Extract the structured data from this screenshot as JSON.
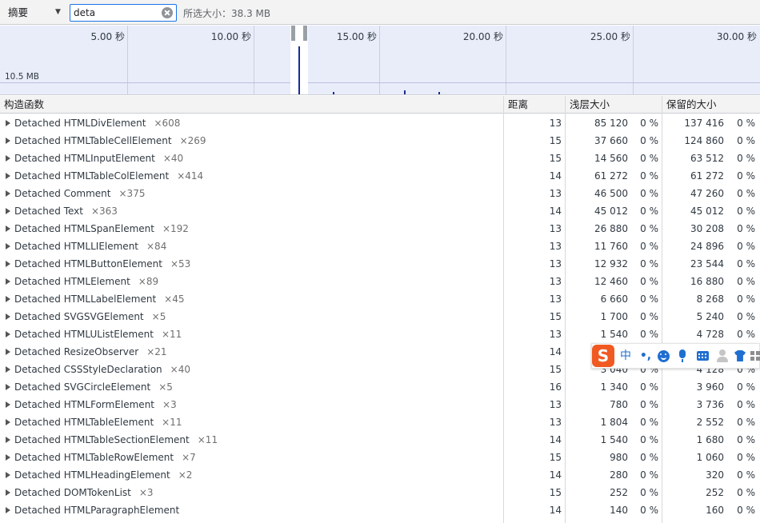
{
  "toolbar": {
    "view_mode": "摘要",
    "filter_value": "deta",
    "selected_size": "所选大小：38.3 MB"
  },
  "timeline": {
    "ticks": [
      "5.00 秒",
      "10.00 秒",
      "15.00 秒",
      "20.00 秒",
      "25.00 秒",
      "30.00 秒"
    ],
    "memory_label": "10.5 MB",
    "accent_color": "#1a2a9c"
  },
  "table": {
    "columns": {
      "constructor": "构造函数",
      "distance": "距离",
      "shallow_size": "浅层大小",
      "retained_size": "保留的大小"
    },
    "rows": [
      {
        "name": "Detached HTMLDivElement",
        "count": "×608",
        "distance": "13",
        "shallow": "85 120",
        "shallow_pct": "0 %",
        "retained": "137 416",
        "retained_pct": "0 %"
      },
      {
        "name": "Detached HTMLTableCellElement",
        "count": "×269",
        "distance": "15",
        "shallow": "37 660",
        "shallow_pct": "0 %",
        "retained": "124 860",
        "retained_pct": "0 %"
      },
      {
        "name": "Detached HTMLInputElement",
        "count": "×40",
        "distance": "15",
        "shallow": "14 560",
        "shallow_pct": "0 %",
        "retained": "63 512",
        "retained_pct": "0 %"
      },
      {
        "name": "Detached HTMLTableColElement",
        "count": "×414",
        "distance": "14",
        "shallow": "61 272",
        "shallow_pct": "0 %",
        "retained": "61 272",
        "retained_pct": "0 %"
      },
      {
        "name": "Detached Comment",
        "count": "×375",
        "distance": "13",
        "shallow": "46 500",
        "shallow_pct": "0 %",
        "retained": "47 260",
        "retained_pct": "0 %"
      },
      {
        "name": "Detached Text",
        "count": "×363",
        "distance": "14",
        "shallow": "45 012",
        "shallow_pct": "0 %",
        "retained": "45 012",
        "retained_pct": "0 %"
      },
      {
        "name": "Detached HTMLSpanElement",
        "count": "×192",
        "distance": "13",
        "shallow": "26 880",
        "shallow_pct": "0 %",
        "retained": "30 208",
        "retained_pct": "0 %"
      },
      {
        "name": "Detached HTMLLIElement",
        "count": "×84",
        "distance": "13",
        "shallow": "11 760",
        "shallow_pct": "0 %",
        "retained": "24 896",
        "retained_pct": "0 %"
      },
      {
        "name": "Detached HTMLButtonElement",
        "count": "×53",
        "distance": "13",
        "shallow": "12 932",
        "shallow_pct": "0 %",
        "retained": "23 544",
        "retained_pct": "0 %"
      },
      {
        "name": "Detached HTMLElement",
        "count": "×89",
        "distance": "13",
        "shallow": "12 460",
        "shallow_pct": "0 %",
        "retained": "16 880",
        "retained_pct": "0 %"
      },
      {
        "name": "Detached HTMLLabelElement",
        "count": "×45",
        "distance": "13",
        "shallow": "6 660",
        "shallow_pct": "0 %",
        "retained": "8 268",
        "retained_pct": "0 %"
      },
      {
        "name": "Detached SVGSVGElement",
        "count": "×5",
        "distance": "15",
        "shallow": "1 700",
        "shallow_pct": "0 %",
        "retained": "5 240",
        "retained_pct": "0 %"
      },
      {
        "name": "Detached HTMLUListElement",
        "count": "×11",
        "distance": "13",
        "shallow": "1 540",
        "shallow_pct": "0 %",
        "retained": "4 728",
        "retained_pct": "0 %"
      },
      {
        "name": "Detached ResizeObserver",
        "count": "×21",
        "distance": "14",
        "shallow": "",
        "shallow_pct": "",
        "retained": "",
        "retained_pct": ""
      },
      {
        "name": "Detached CSSStyleDeclaration",
        "count": "×40",
        "distance": "15",
        "shallow": "3 040",
        "shallow_pct": "0 %",
        "retained": "4 128",
        "retained_pct": "0 %"
      },
      {
        "name": "Detached SVGCircleElement",
        "count": "×5",
        "distance": "16",
        "shallow": "1 340",
        "shallow_pct": "0 %",
        "retained": "3 960",
        "retained_pct": "0 %"
      },
      {
        "name": "Detached HTMLFormElement",
        "count": "×3",
        "distance": "13",
        "shallow": "780",
        "shallow_pct": "0 %",
        "retained": "3 736",
        "retained_pct": "0 %"
      },
      {
        "name": "Detached HTMLTableElement",
        "count": "×11",
        "distance": "13",
        "shallow": "1 804",
        "shallow_pct": "0 %",
        "retained": "2 552",
        "retained_pct": "0 %"
      },
      {
        "name": "Detached HTMLTableSectionElement",
        "count": "×11",
        "distance": "14",
        "shallow": "1 540",
        "shallow_pct": "0 %",
        "retained": "1 680",
        "retained_pct": "0 %"
      },
      {
        "name": "Detached HTMLTableRowElement",
        "count": "×7",
        "distance": "15",
        "shallow": "980",
        "shallow_pct": "0 %",
        "retained": "1 060",
        "retained_pct": "0 %"
      },
      {
        "name": "Detached HTMLHeadingElement",
        "count": "×2",
        "distance": "14",
        "shallow": "280",
        "shallow_pct": "0 %",
        "retained": "320",
        "retained_pct": "0 %"
      },
      {
        "name": "Detached DOMTokenList",
        "count": "×3",
        "distance": "15",
        "shallow": "252",
        "shallow_pct": "0 %",
        "retained": "252",
        "retained_pct": "0 %"
      },
      {
        "name": "Detached HTMLParagraphElement",
        "count": "",
        "distance": "14",
        "shallow": "140",
        "shallow_pct": "0 %",
        "retained": "160",
        "retained_pct": "0 %"
      }
    ]
  },
  "ime": {
    "logo": "S",
    "lang": "中",
    "punct": "•,",
    "brand_color": "#f05a22",
    "icons": [
      "emoji-icon",
      "microphone-icon",
      "keyboard-icon",
      "user-icon",
      "skin-icon",
      "toolbox-icon"
    ]
  }
}
